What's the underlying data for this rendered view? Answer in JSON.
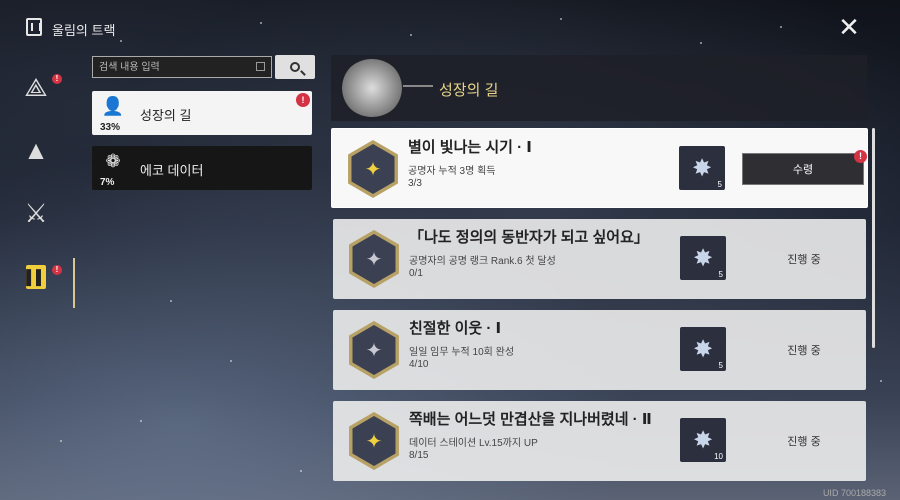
{
  "window": {
    "title": "울림의 트랙",
    "close_icon": "close-icon"
  },
  "rail": {
    "items": [
      {
        "icon": "wave-slash-icon",
        "badge": "!"
      },
      {
        "icon": "peak-icon",
        "badge": ""
      },
      {
        "icon": "crossed-swords-icon",
        "badge": ""
      },
      {
        "icon": "track-icon",
        "badge": "!",
        "active": true
      }
    ]
  },
  "search": {
    "placeholder": "검색 내용 입력",
    "value": ""
  },
  "categories": [
    {
      "label": "성장의 길",
      "percent": "33%",
      "badge": "!",
      "selected": true
    },
    {
      "label": "에코 데이터",
      "percent": "7%",
      "badge": "",
      "selected": false
    }
  ],
  "panel": {
    "title": "성장의 길"
  },
  "tasks": [
    {
      "title": "별이 빛나는 시기 · Ⅰ",
      "description": "공명자 누적 3명 획득",
      "progress": "3/3",
      "reward_count": "5",
      "action": "수령",
      "action_badge": "!",
      "state": "claimable",
      "icon_color": "gold"
    },
    {
      "title": "「나도 정의의 동반자가 되고 싶어요」",
      "description": "공명자의 공명 랭크 Rank.6 첫 달성",
      "progress": "0/1",
      "reward_count": "5",
      "action": "진행 중",
      "state": "in-progress",
      "icon_color": "grey"
    },
    {
      "title": "친절한 이웃 · Ⅰ",
      "description": "일일 임무 누적 10회 완성",
      "progress": "4/10",
      "reward_count": "5",
      "action": "진행 중",
      "state": "in-progress",
      "icon_color": "grey"
    },
    {
      "title": "쪽배는 어느덧 만겹산을 지나버렸네 · Ⅱ",
      "description": "데이터 스테이션 Lv.15까지 UP",
      "progress": "8/15",
      "reward_count": "10",
      "action": "진행 중",
      "state": "in-progress",
      "icon_color": "gold"
    }
  ],
  "footer": {
    "uid": "UID 700188383"
  },
  "colors": {
    "accent_gold": "#e8d58a",
    "badge_red": "#d43344",
    "rail_active": "#f1cf3a"
  }
}
